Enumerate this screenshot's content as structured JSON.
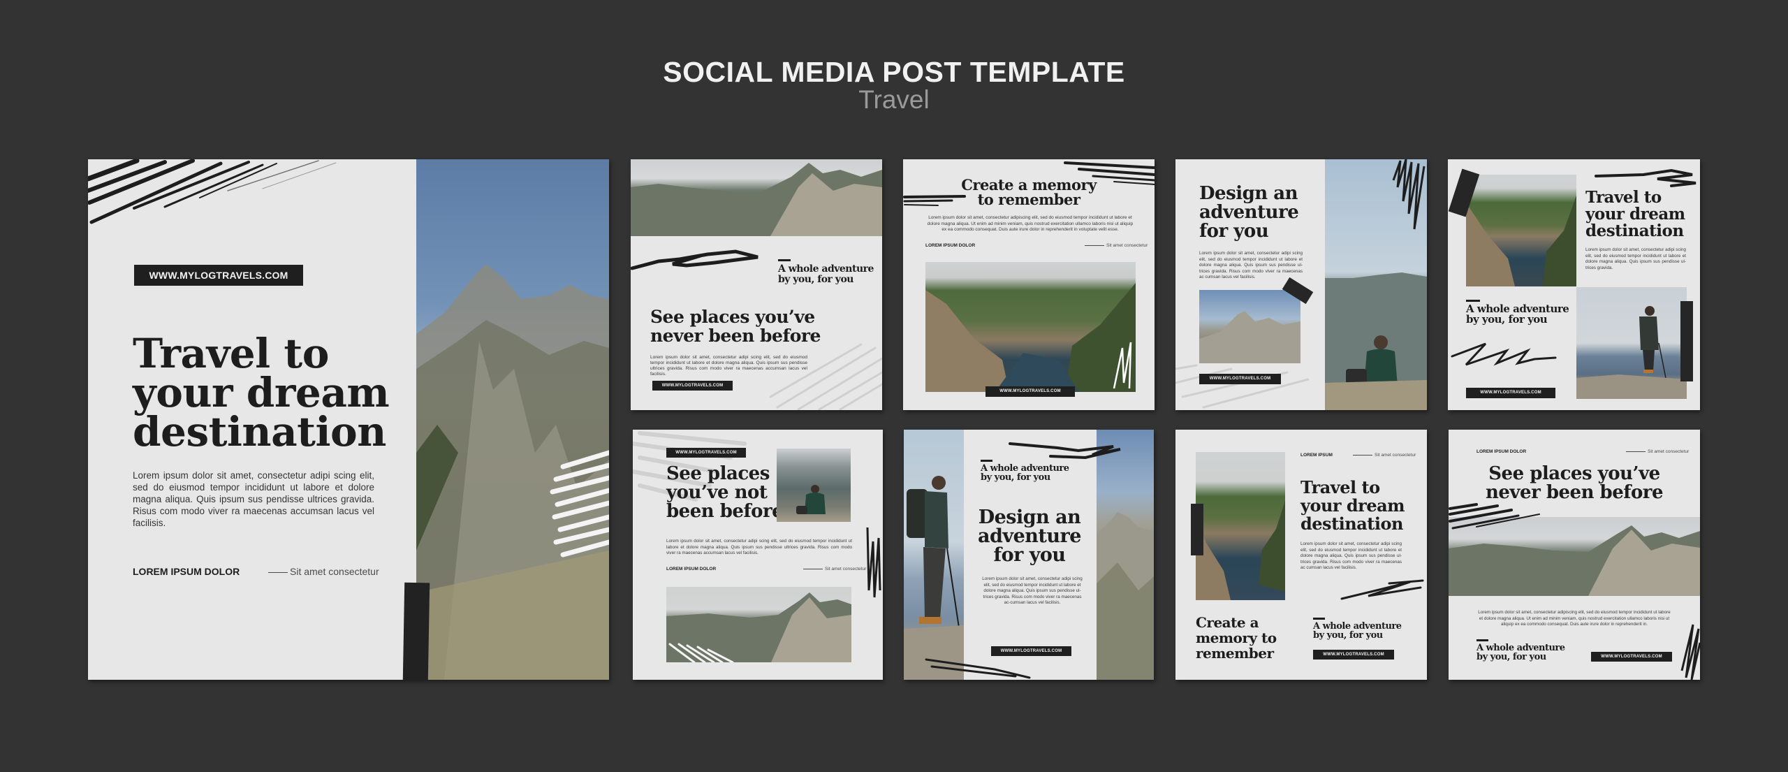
{
  "header": {
    "title": "SOCIAL MEDIA POST TEMPLATE",
    "subtitle": "Travel"
  },
  "colors": {
    "background": "#333333",
    "card": "#e8e7e7",
    "ink": "#1d1d1d",
    "subtitle": "#9a9a9a"
  },
  "common": {
    "url": "WWW.MYLOGTRAVELS.COM",
    "meta_left": "LOREM IPSUM DOLOR",
    "meta_left_short": "LOREM IPSUM",
    "meta_right": "Sit amet consectetur",
    "tagline": "A whole adventure by you, for you",
    "tagline_line1": "A whole adventure",
    "tagline_line2": "by you, for you"
  },
  "story": {
    "url": "WWW.MYLOGTRAVELS.COM",
    "headline": [
      "Travel to",
      "your dream",
      "destination"
    ],
    "body": "Lorem ipsum dolor sit amet, consectetur adipi scing elit, sed do eiusmod tempor incididunt ut labore et dolore magna aliqua. Quis ipsum sus pendisse ultrices gravida. Risus com modo viver ra maecenas accumsan lacus vel facilisis.",
    "meta_left": "LOREM IPSUM DOLOR",
    "meta_right": "Sit amet consectetur"
  },
  "posts": [
    {
      "id": "post-1",
      "headline": [
        "See places you’ve",
        "never been before"
      ],
      "tagline": [
        "A whole adventure",
        "by you, for you"
      ],
      "body": "Lorem ipsum dolor sit amet, consectetur adipi scing elit, sed do eiusmod tempor incididunt ut labore et dolore magna aliqua. Quis ipsum sus pendisse ultrices gravida. Risus com modo viver ra maecenas accumsan lacus vel facilisis.",
      "url": "WWW.MYLOGTRAVELS.COM"
    },
    {
      "id": "post-2",
      "headline": [
        "Create a memory",
        "to remember"
      ],
      "body": "Lorem ipsum dolor sit amet, consectetur adipiscing elit, sed do eiusmod tempor incididunt ut labore et dolore magna aliqua. Ut enim ad minim veniam, quis nostrud exercitation ullamco laboris nisi ut aliquip ex ea commodo consequat. Duis aute irure dolor in reprehenderit in voluptate velit esse.",
      "meta_left": "LOREM IPSUM DOLOR",
      "meta_right": "Sit amet consectetur",
      "url": "WWW.MYLOGTRAVELS.COM"
    },
    {
      "id": "post-3",
      "headline": [
        "Design an",
        "adventure",
        "for you"
      ],
      "body": "Lorem ipsum dolor sit amet, consectetur adipi scing elit, sed do eiusmod tempor incididunt ut labore et dolore magna aliqua. Quis ipsum sus pendisse ul-trices gravida. Risus com modo viver ra maecenas ac cumsan lacus vel facilisis.",
      "url": "WWW.MYLOGTRAVELS.COM"
    },
    {
      "id": "post-4",
      "headline": [
        "Travel to",
        "your dream",
        "destination"
      ],
      "body": "Lorem ipsum dolor sit amet, consectetur adipi scing elit, sed do eiusmod tempor incididunt ut labore et dolore magna aliqua. Quis ipsum sus pendisse ul-trices gravida.",
      "tagline": [
        "A whole adventure",
        "by you, for you"
      ],
      "url": "WWW.MYLOGTRAVELS.COM"
    },
    {
      "id": "post-5",
      "url": "WWW.MYLOGTRAVELS.COM",
      "headline": [
        "See places",
        "you’ve not",
        "been before"
      ],
      "body": "Lorem ipsum dolor sit amet, consectetur adipi scing elit, sed do eiusmod tempor incididunt ut labore et dolore magna aliqua. Quis ipsum sus pendisse ultrices gravida. Risus com modo viver ra maecenas accumsan lacus vel facilisis.",
      "meta_left": "LOREM IPSUM DOLOR",
      "meta_right": "Sit amet consectetur"
    },
    {
      "id": "post-6",
      "tagline": [
        "A whole adventure",
        "by you, for you"
      ],
      "headline": [
        "Design an",
        "adventure",
        "for you"
      ],
      "body": "Lorem ipsum dolor sit amet, consectetur adipi scing elit, sed do eiusmod tempor incididunt ut labore et dolore magna aliqua. Quis ipsum sus pendisse ul-trices gravida. Risus com modo viver ra maecenas ac-cumsan lacus vel facilisis.",
      "url": "WWW.MYLOGTRAVELS.COM"
    },
    {
      "id": "post-7",
      "meta_left": "LOREM IPSUM",
      "meta_right": "Sit amet consectetur",
      "headline": [
        "Travel to",
        "your dream",
        "destination"
      ],
      "body": "Lorem ipsum dolor sit amet, consectetur adipi scing elit, sed do eiusmod tempor incididunt ut labore et dolore magna aliqua. Quis ipsum sus pendisse ul-trices gravida. Risus com modo viver ra maecenas ac cumsan lacus vel facilisis.",
      "headline2": [
        "Create a",
        "memory to",
        "remember"
      ],
      "tagline": [
        "A whole adventure",
        "by you, for you"
      ],
      "url": "WWW.MYLOGTRAVELS.COM"
    },
    {
      "id": "post-8",
      "meta_left": "LOREM IPSUM DOLOR",
      "meta_right": "Sit amet consectetur",
      "headline": [
        "See places you’ve",
        "never been before"
      ],
      "body": "Lorem ipsum dolor sit amet, consectetur adipiscing elit, sed do eiusmod tempor incididunt ut labore et dolore magna aliqua. Ut enim ad minim veniam, quis nostrud exercitation ullamco laboris nisi ut aliquip ex ea commodo consequat. Duis aute irure dolor in reprehenderit in.",
      "tagline": [
        "A whole adventure",
        "by you, for you"
      ],
      "url": "WWW.MYLOGTRAVELS.COM"
    }
  ]
}
